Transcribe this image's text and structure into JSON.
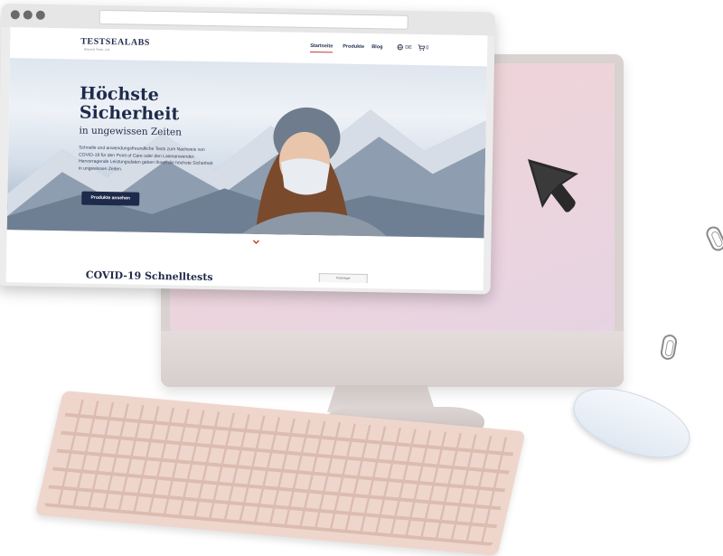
{
  "site": {
    "logo": "TESTSEALABS",
    "logo_tagline": "Beyond Tests. Ltd.",
    "nav": [
      "Startseite",
      "Produkte",
      "Blog"
    ],
    "language": "DE",
    "cart_count": "0"
  },
  "hero": {
    "title_line1": "Höchste",
    "title_line2": "Sicherheit",
    "subtitle": "in ungewissen Zeiten",
    "text": "Schnelle und anwendungsfreundliche Tests zum Nachweis von COVID-19 für den Point of Care oder den Laienanwender. Hervorragende Leistungsdaten geben Ihnen die höchste Sicherheit in ungewissen Zeiten.",
    "button": "Produkte ansehen"
  },
  "section": {
    "title": "COVID-19 Schnelltests",
    "mini_tab": "Testsieger"
  },
  "colors": {
    "brand_navy": "#1e2a4a",
    "accent_red": "#c0392b",
    "monitor_screen": "#ecd4dc"
  },
  "icons": [
    "globe-icon",
    "cart-icon",
    "chevron-down-icon",
    "cursor-icon",
    "paperclip-icon"
  ]
}
